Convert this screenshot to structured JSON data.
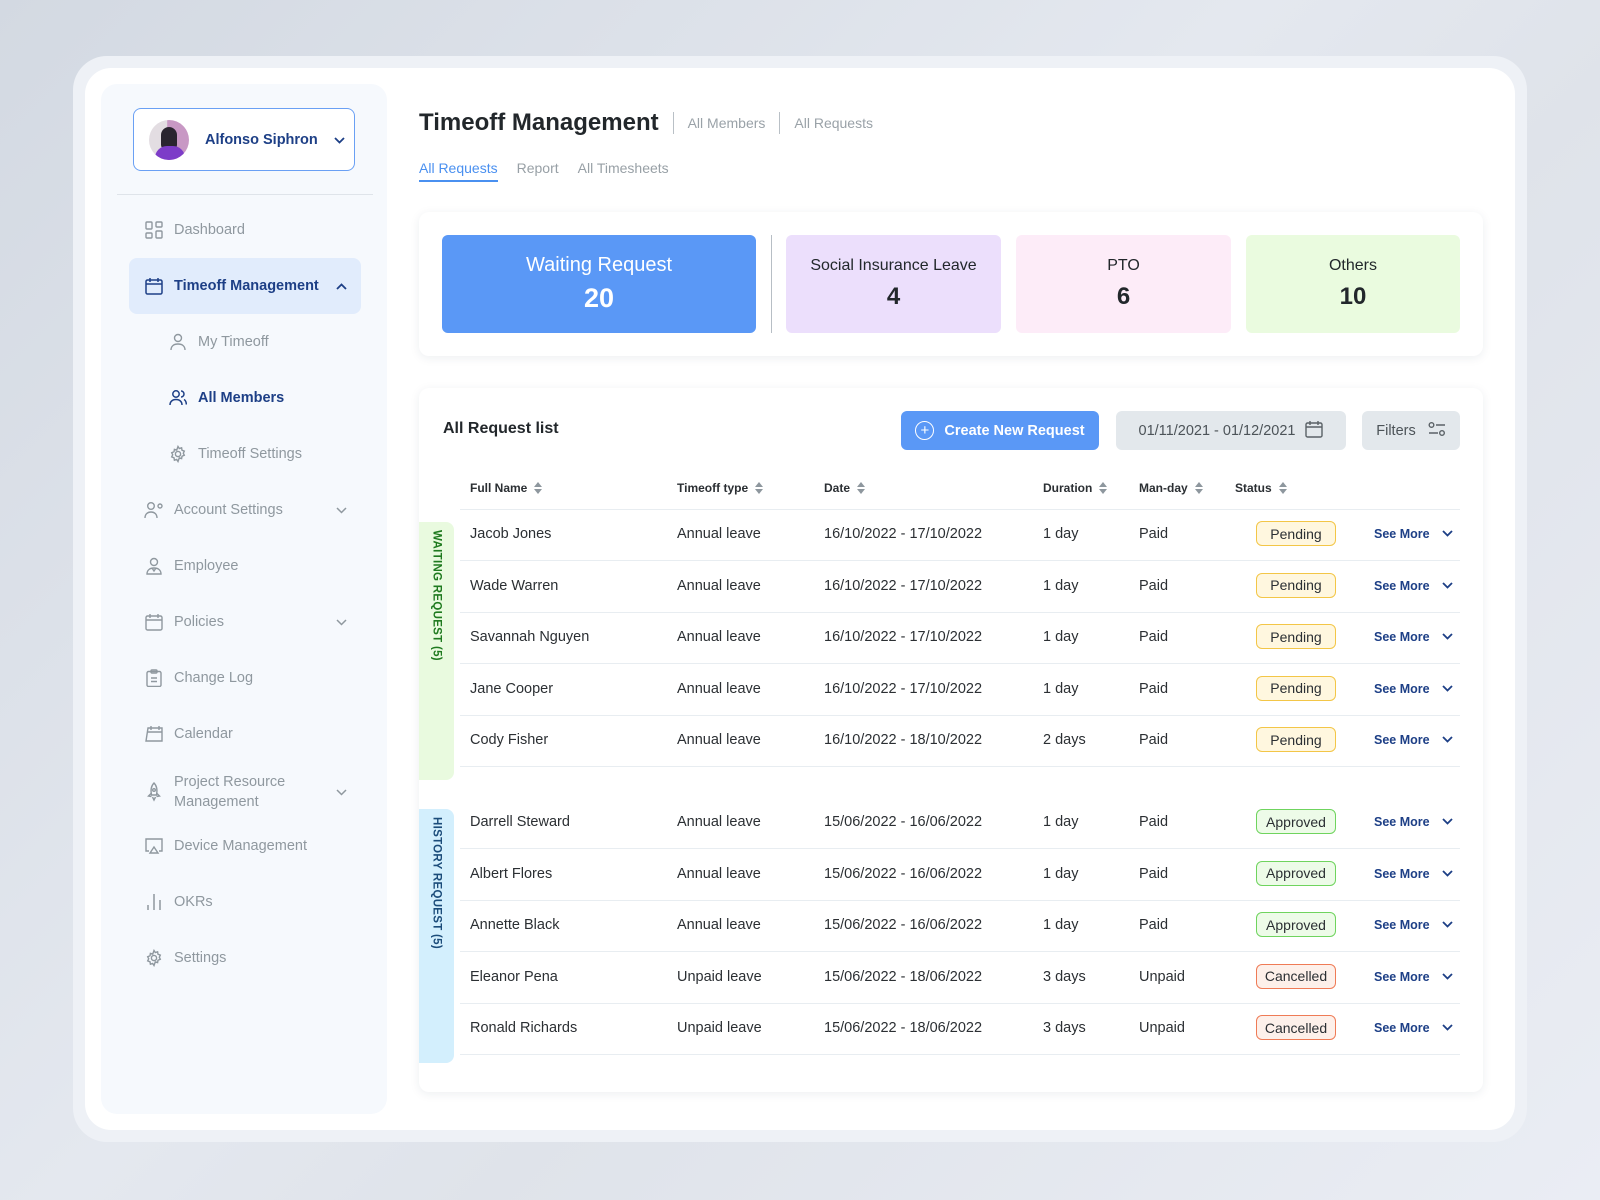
{
  "sidebar": {
    "user": {
      "name": "Alfonso Siphron"
    },
    "items": [
      {
        "label": "Dashboard",
        "icon": "dashboard-grid-icon"
      },
      {
        "label": "Timeoff Management",
        "icon": "calendar-icon",
        "active": true,
        "expanded": true
      },
      {
        "label": "My Timeoff",
        "icon": "user-icon",
        "sub": true
      },
      {
        "label": "All Members",
        "icon": "users-icon",
        "sub": true,
        "current": true
      },
      {
        "label": "Timeoff  Settings",
        "icon": "gear-icon",
        "sub": true
      },
      {
        "label": "Account Settings",
        "icon": "user-settings-icon",
        "expandable": true
      },
      {
        "label": "Employee",
        "icon": "employee-icon"
      },
      {
        "label": "Policies",
        "icon": "calendar-icon",
        "expandable": true
      },
      {
        "label": "Change Log",
        "icon": "clipboard-icon"
      },
      {
        "label": "Calendar",
        "icon": "calendar-page-icon"
      },
      {
        "label": "Project Resource Management",
        "icon": "rocket-icon",
        "expandable": true
      },
      {
        "label": "Device Management",
        "icon": "monitor-icon"
      },
      {
        "label": "OKRs",
        "icon": "bar-chart-icon"
      },
      {
        "label": "Settings",
        "icon": "gear-icon"
      }
    ]
  },
  "header": {
    "title": "Timeoff Management",
    "breadcrumbs": [
      "All Members",
      "All Requests"
    ],
    "tabs": [
      {
        "label": "All Requests",
        "active": true
      },
      {
        "label": "Report"
      },
      {
        "label": "All Timesheets"
      }
    ]
  },
  "stats": [
    {
      "label": "Waiting Request",
      "value": "20",
      "color": "#5a98f6"
    },
    {
      "label": "Social Insurance Leave",
      "value": "4",
      "color": "#ecdffc"
    },
    {
      "label": "PTO",
      "value": "6",
      "color": "#fdecf8"
    },
    {
      "label": "Others",
      "value": "10",
      "color": "#eafbdf"
    }
  ],
  "list": {
    "title": "All Request list",
    "create_label": "Create New Request",
    "date_range": "01/11/2021 - 01/12/2021",
    "filters_label": "Filters",
    "columns": [
      "Full Name",
      "Timeoff type",
      "Date",
      "Duration",
      "Man-day",
      "Status"
    ],
    "see_more_label": "See More",
    "sections": [
      {
        "label": "WAITING REQUEST (5)",
        "rows": [
          {
            "name": "Jacob Jones",
            "type": "Annual leave",
            "date": "16/10/2022 - 17/10/2022",
            "duration": "1 day",
            "manday": "Paid",
            "status": "Pending"
          },
          {
            "name": "Wade Warren",
            "type": "Annual leave",
            "date": "16/10/2022 - 17/10/2022",
            "duration": "1 day",
            "manday": "Paid",
            "status": "Pending"
          },
          {
            "name": "Savannah Nguyen",
            "type": "Annual leave",
            "date": "16/10/2022 - 17/10/2022",
            "duration": "1 day",
            "manday": "Paid",
            "status": "Pending"
          },
          {
            "name": "Jane Cooper",
            "type": "Annual leave",
            "date": "16/10/2022 - 17/10/2022",
            "duration": "1 day",
            "manday": "Paid",
            "status": "Pending"
          },
          {
            "name": "Cody Fisher",
            "type": "Annual leave",
            "date": "16/10/2022 - 18/10/2022",
            "duration": "2 days",
            "manday": "Paid",
            "status": "Pending"
          }
        ]
      },
      {
        "label": "HISTORY  REQUEST (5)",
        "rows": [
          {
            "name": "Darrell Steward",
            "type": "Annual leave",
            "date": "15/06/2022 - 16/06/2022",
            "duration": "1 day",
            "manday": "Paid",
            "status": "Approved"
          },
          {
            "name": "Albert Flores",
            "type": "Annual leave",
            "date": "15/06/2022 - 16/06/2022",
            "duration": "1 day",
            "manday": "Paid",
            "status": "Approved"
          },
          {
            "name": "Annette Black",
            "type": "Annual leave",
            "date": "15/06/2022 - 16/06/2022",
            "duration": "1 day",
            "manday": "Paid",
            "status": "Approved"
          },
          {
            "name": "Eleanor Pena",
            "type": "Unpaid leave",
            "date": "15/06/2022 - 18/06/2022",
            "duration": "3 days",
            "manday": "Unpaid",
            "status": "Cancelled"
          },
          {
            "name": "Ronald Richards",
            "type": "Unpaid leave",
            "date": "15/06/2022 - 18/06/2022",
            "duration": "3 days",
            "manday": "Unpaid",
            "status": "Cancelled"
          }
        ]
      }
    ]
  },
  "colors": {
    "accent": "#5a98f6",
    "nav_active_bg": "#e1ecfc",
    "nav_active_text": "#1d3f86",
    "pending": "#f3c647",
    "approved": "#6fd45e",
    "cancelled": "#ef7b56"
  }
}
